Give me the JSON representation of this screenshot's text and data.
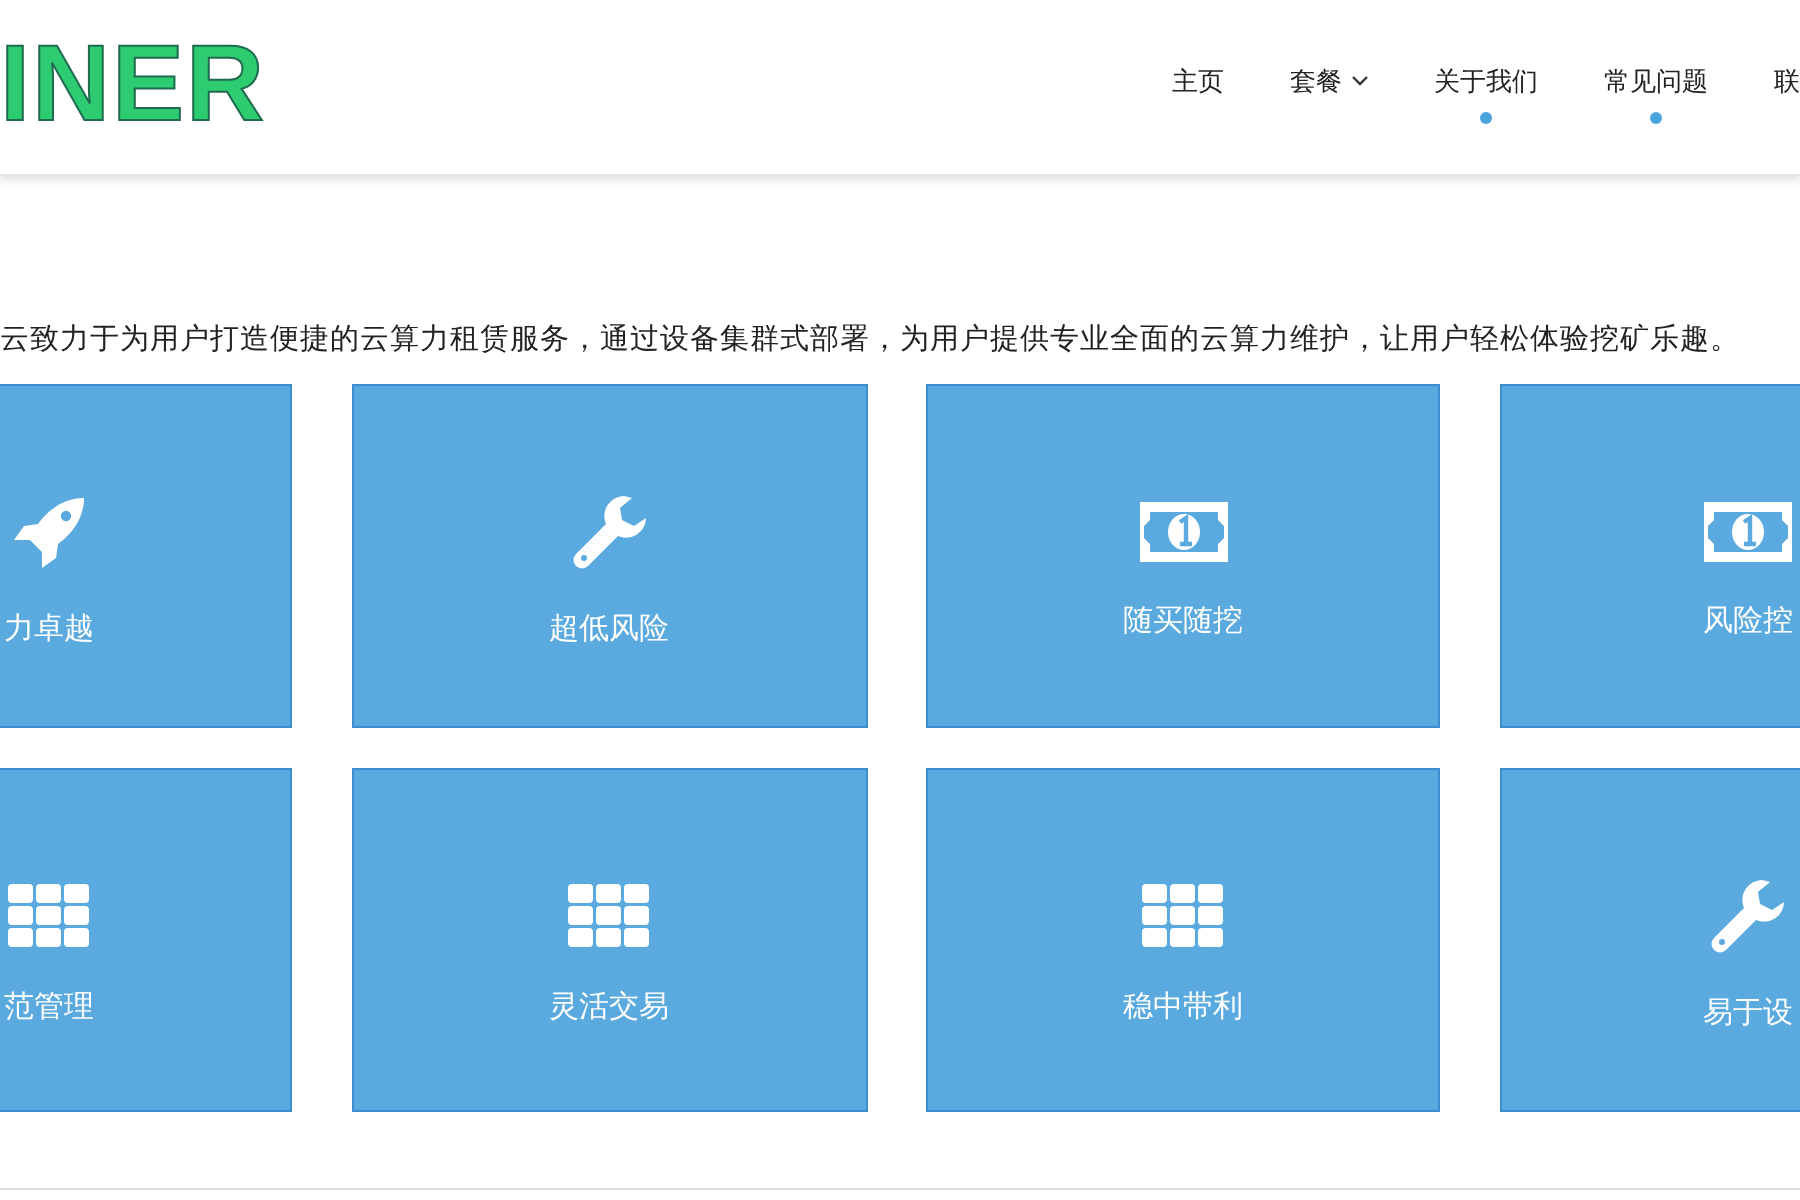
{
  "logo": "INER",
  "nav": [
    {
      "label": "主页",
      "dropdown": false,
      "dot": false
    },
    {
      "label": "套餐",
      "dropdown": true,
      "dot": false
    },
    {
      "label": "关于我们",
      "dropdown": false,
      "dot": true
    },
    {
      "label": "常见问题",
      "dropdown": false,
      "dot": true
    },
    {
      "label": "联",
      "dropdown": false,
      "dot": false
    }
  ],
  "intro": "云致力于为用户打造便捷的云算力租赁服务，通过设备集群式部署，为用户提供专业全面的云算力维护，让用户轻松体验挖矿乐趣。",
  "features": [
    {
      "kind": "rocket",
      "label": "力卓越"
    },
    {
      "kind": "wrench",
      "label": "超低风险"
    },
    {
      "kind": "banknote",
      "label": "随买随挖"
    },
    {
      "kind": "banknote",
      "label": "风险控"
    },
    {
      "kind": "grid",
      "label": "范管理"
    },
    {
      "kind": "grid",
      "label": "灵活交易"
    },
    {
      "kind": "grid",
      "label": "稳中带利"
    },
    {
      "kind": "wrench",
      "label": "易于设"
    }
  ]
}
